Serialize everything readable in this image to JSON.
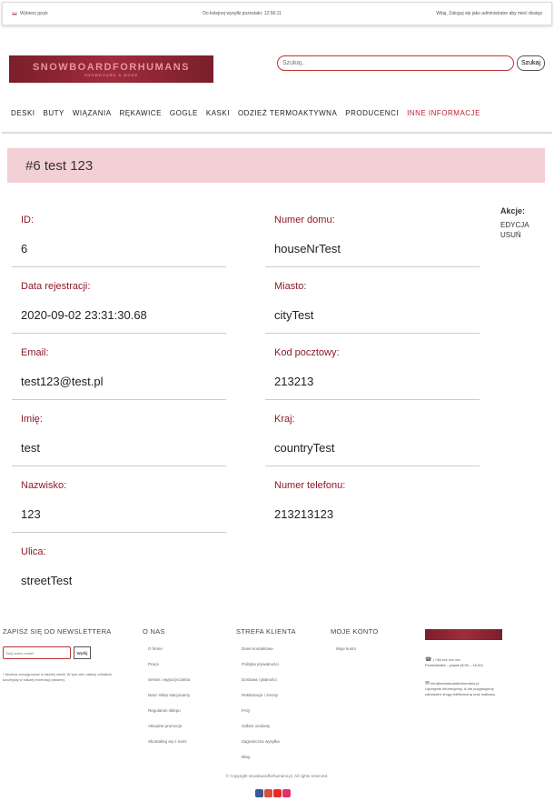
{
  "topbar": {
    "language": "Wybierz język",
    "shipping": "Do kolejnej wysyłki pozostało: 12:56:11",
    "welcome": "Witaj, Zaloguj się jako administrator aby mieć dostęp"
  },
  "logo": {
    "title": "SNOWBOARDFORHUMANS",
    "subtitle": "SNOWBOARD & MORE"
  },
  "search": {
    "placeholder": "Szukaj..",
    "button": "Szukaj"
  },
  "nav": [
    "DESKI",
    "BUTY",
    "WIĄZANIA",
    "RĘKAWICE",
    "GOGLE",
    "KASKI",
    "ODZIEŻ TERMOAKTYWNA",
    "PRODUCENCI",
    "INNE INFORMACJE"
  ],
  "page_title": "#6 test 123",
  "left_fields": [
    {
      "label": "ID:",
      "value": "6"
    },
    {
      "label": "Data rejestracji:",
      "value": "2020-09-02 23:31:30.68"
    },
    {
      "label": "Email:",
      "value": "test123@test.pl"
    },
    {
      "label": "Imię:",
      "value": "test"
    },
    {
      "label": "Nazwisko:",
      "value": "123"
    },
    {
      "label": "Ulica:",
      "value": "streetTest"
    }
  ],
  "right_fields": [
    {
      "label": "Numer domu:",
      "value": "houseNrTest"
    },
    {
      "label": "Miasto:",
      "value": "cityTest"
    },
    {
      "label": "Kod pocztowy:",
      "value": "213213"
    },
    {
      "label": "Kraj:",
      "value": "countryTest"
    },
    {
      "label": "Numer telefonu:",
      "value": "213213123"
    }
  ],
  "actions": {
    "title": "Akcje:",
    "edit": "EDYCJA",
    "delete": "USUŃ"
  },
  "footer": {
    "newsletter": {
      "title": "ZAPISZ SIĘ DO NEWSLETTERA",
      "placeholder": "Twój adres email*",
      "button": "Wyślij",
      "note": "* Możesz zrezygnować w każdej chwili. W tym celu należy odnaleźć szczegóły w naszej informacji prawnej."
    },
    "about": {
      "title": "O NAS",
      "links": [
        "O firmie",
        "Praca",
        "Serwis i wypożyczalnia",
        "Nasz sklep stacjonarny",
        "Regulamin sklepu",
        "Aktualne promocje",
        "Skontaktuj się z nami"
      ]
    },
    "client": {
      "title": "STREFA KLIENTA",
      "links": [
        "Dane kontaktowe",
        "Polityka prywatności",
        "Dostawa i płatności",
        "Reklamacje i zwroty",
        "FAQ",
        "Odbiór osobisty",
        "Zagraniczna wysyłka",
        "Blog"
      ]
    },
    "account": {
      "title": "MOJE KONTO",
      "links": [
        "Moje konto"
      ]
    },
    "contact": {
      "phone": "| +48 xxx xxx xxx",
      "hours": "Poniedziałek – piątek (8:00 – 16:00)",
      "email": "info@snowboardforhumans.pl",
      "note": "Uprzejmie informujemy, iż nie przyjmujemy zamówień drogą telefoniczną oraz mailową."
    },
    "copyright": "© Copyright snowboardforhumans.pl. All rights reserved."
  }
}
